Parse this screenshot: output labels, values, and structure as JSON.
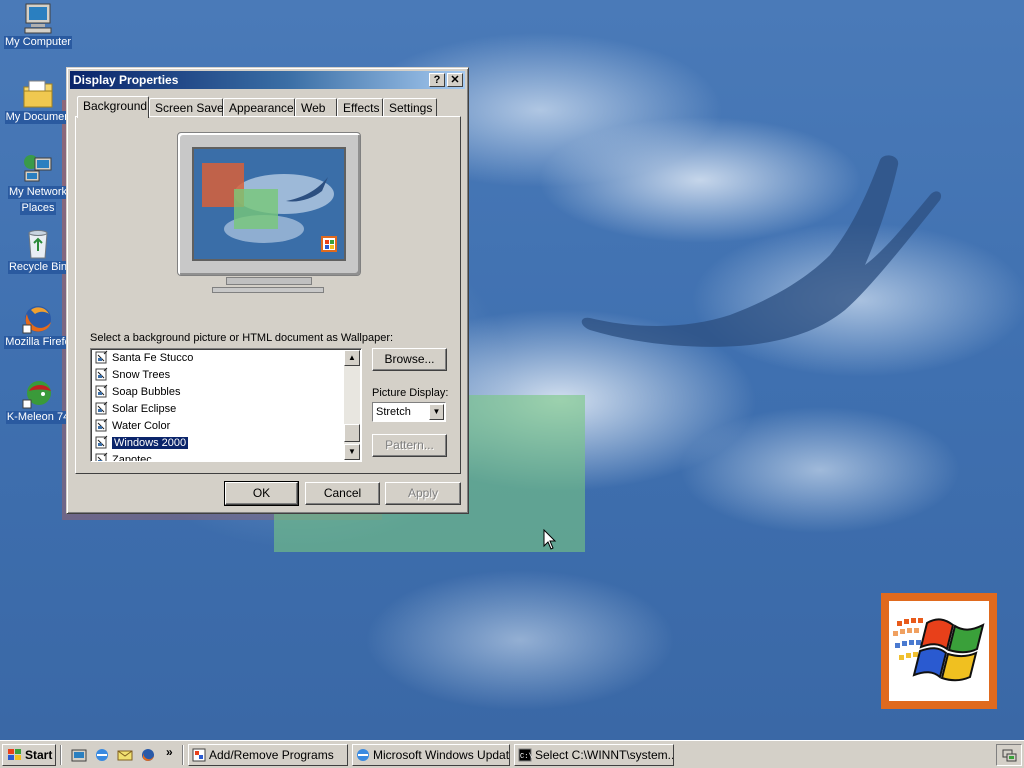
{
  "desktop": {
    "icons": [
      {
        "label": "My Computer",
        "icon": "my-computer-icon"
      },
      {
        "label": "My Documen",
        "icon": "my-documents-icon"
      },
      {
        "label": "My Network",
        "label2": "Places",
        "icon": "network-places-icon"
      },
      {
        "label": "Recycle Bin",
        "icon": "recycle-bin-icon"
      },
      {
        "label": "Mozilla Firefo",
        "icon": "firefox-icon"
      },
      {
        "label": "K-Meleon 74",
        "icon": "k-meleon-icon"
      }
    ]
  },
  "dialog": {
    "title": "Display Properties",
    "help_button": "?",
    "close_button": "✕",
    "tabs": [
      "Background",
      "Screen Saver",
      "Appearance",
      "Web",
      "Effects",
      "Settings"
    ],
    "active_tab": "Background",
    "prompt": "Select a background picture or HTML document as Wallpaper:",
    "wallpapers": [
      "Santa Fe Stucco",
      "Snow Trees",
      "Soap Bubbles",
      "Solar Eclipse",
      "Water Color",
      "Windows 2000",
      "Zapotec"
    ],
    "selected_wallpaper": "Windows 2000",
    "browse_button": "Browse...",
    "picture_display_label": "Picture Display:",
    "picture_display_value": "Stretch",
    "pattern_button": "Pattern...",
    "ok_button": "OK",
    "cancel_button": "Cancel",
    "apply_button": "Apply"
  },
  "taskbar": {
    "start_label": "Start",
    "quick_launch_more": "»",
    "tasks": [
      {
        "label": "Add/Remove Programs",
        "icon": "add-remove-programs-icon"
      },
      {
        "label": "Microsoft Windows Updat...",
        "icon": "ie-window-icon"
      },
      {
        "label": "Select C:\\WINNT\\system...",
        "icon": "command-prompt-icon"
      }
    ]
  },
  "colors": {
    "titlebar_start": "#0a246a",
    "titlebar_end": "#a6caf0",
    "selection": "#0a246a",
    "face": "#d4d0c8",
    "logo_frame": "#e06a1e"
  }
}
